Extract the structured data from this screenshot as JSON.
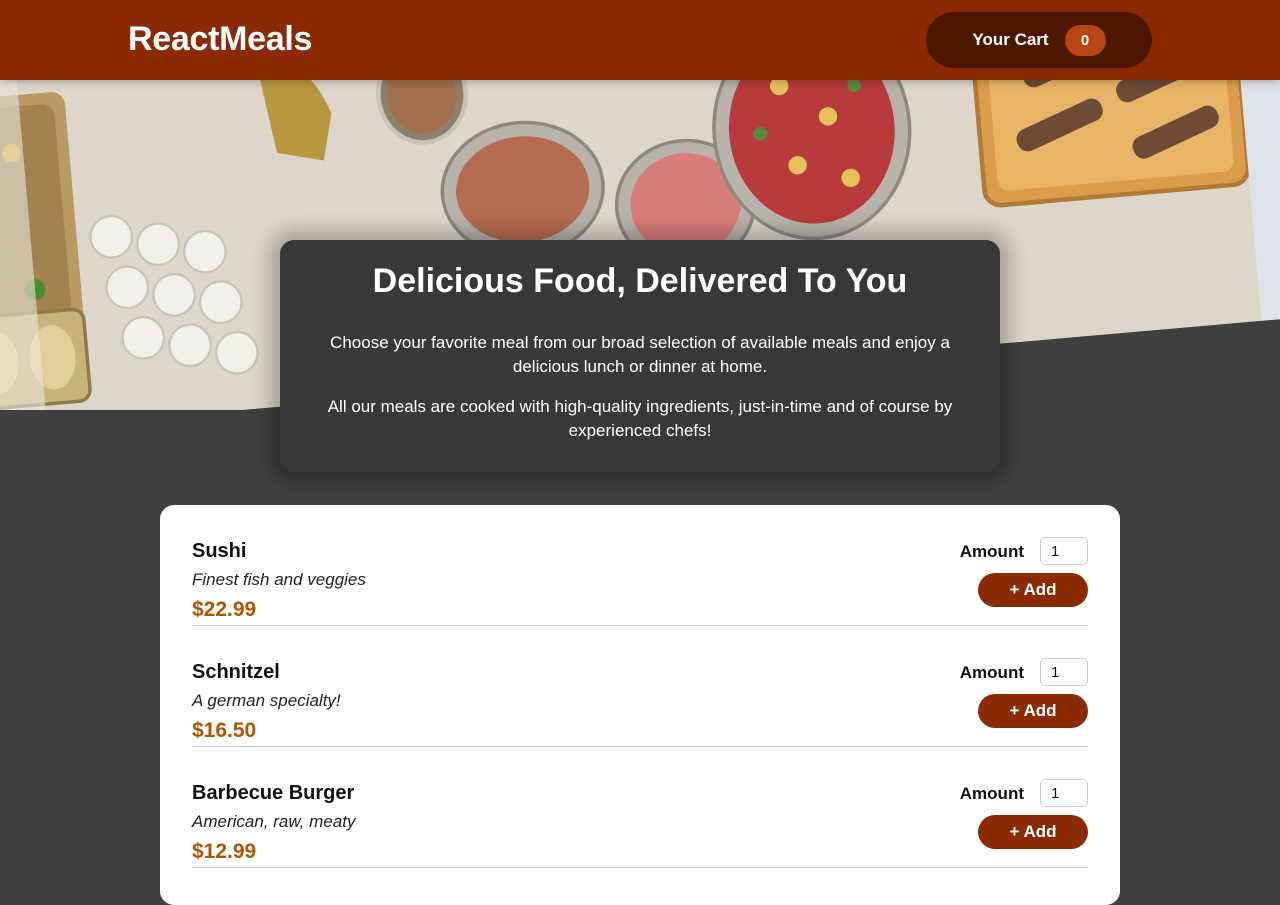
{
  "header": {
    "brand": "ReactMeals",
    "cart_label": "Your Cart",
    "cart_count": "0"
  },
  "hero": {
    "image_description": "buffet tables with catered food trays"
  },
  "summary": {
    "title": "Delicious Food, Delivered To You",
    "paragraph_1": "Choose your favorite meal from our broad selection of available meals and enjoy a delicious lunch or dinner at home.",
    "paragraph_2": "All our meals are cooked with high-quality ingredients, just-in-time and of course by experienced chefs!"
  },
  "meals": [
    {
      "name": "Sushi",
      "description": "Finest fish and veggies",
      "price": "$22.99",
      "amount_label": "Amount",
      "amount": "1",
      "add_label": "+ Add"
    },
    {
      "name": "Schnitzel",
      "description": "A german specialty!",
      "price": "$16.50",
      "amount_label": "Amount",
      "amount": "1",
      "add_label": "+ Add"
    },
    {
      "name": "Barbecue Burger",
      "description": "American, raw, meaty",
      "price": "$12.99",
      "amount_label": "Amount",
      "amount": "1",
      "add_label": "+ Add"
    }
  ],
  "colors": {
    "header_bg": "#8a2b06",
    "cart_button_bg": "#4d1601",
    "cart_badge_bg": "#b94517",
    "page_bg": "#3f3f3f",
    "summary_bg": "#383838",
    "price": "#ad5502"
  }
}
